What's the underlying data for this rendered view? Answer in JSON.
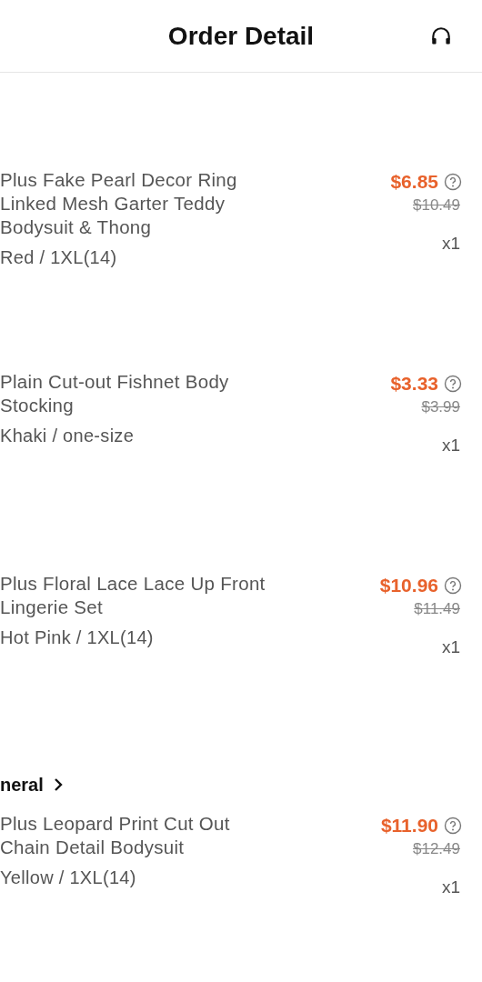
{
  "header": {
    "title": "Order Detail"
  },
  "sections": [
    {
      "kind": "product",
      "name": "Plus Fake Pearl Decor Ring Linked Mesh Garter Teddy Bodysuit & Thong",
      "variant": "Red / 1XL(14)",
      "price": "$6.85",
      "original_price": "$10.49",
      "quantity": "x1"
    },
    {
      "kind": "product",
      "name": "Plain Cut-out Fishnet Body Stocking",
      "variant": "Khaki / one-size",
      "price": "$3.33",
      "original_price": "$3.99",
      "quantity": "x1"
    },
    {
      "kind": "product",
      "name": "Plus Floral Lace Lace Up Front Lingerie Set",
      "variant": "Hot Pink / 1XL(14)",
      "price": "$10.96",
      "original_price": "$11.49",
      "quantity": "x1"
    },
    {
      "kind": "store",
      "label": "neral"
    },
    {
      "kind": "product",
      "name": "Plus Leopard Print Cut Out Chain Detail Bodysuit",
      "variant": "Yellow / 1XL(14)",
      "price": "$11.90",
      "original_price": "$12.49",
      "quantity": "x1"
    }
  ]
}
